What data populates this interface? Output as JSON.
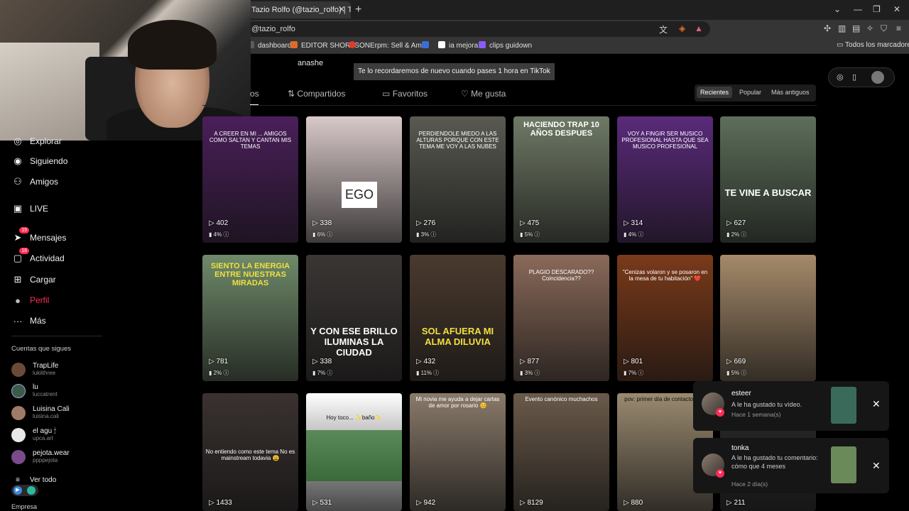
{
  "browser": {
    "tab_title": "Tazio Rolfo (@tazio_rolfo) | TikTok",
    "tab_close": "✕",
    "new_tab": "+",
    "url": "@tazio_rolfo",
    "window_controls": [
      "⌄",
      "—",
      "❐",
      "✕"
    ],
    "bookmarks": [
      {
        "label": "dashboard",
        "color": "#5b5b5b"
      },
      {
        "label": "EDITOR SHORTS",
        "color": "#e06a2c"
      },
      {
        "label": "ONErpm: Sell & Am...",
        "color": "#e03a2c"
      },
      {
        "label": "",
        "color": "#3b6fd8"
      },
      {
        "label": "ia mejora",
        "color": "#ffffff"
      },
      {
        "label": "clips guidown",
        "color": "#8a5cf6"
      }
    ],
    "bookmarks_folder": "Todos los marcadores"
  },
  "sidebar": {
    "items": [
      {
        "label": "Explorar",
        "icon": "compass-icon",
        "glyph": "◎"
      },
      {
        "label": "Siguiendo",
        "icon": "following-avatar-icon",
        "glyph": "◉"
      },
      {
        "label": "Amigos",
        "icon": "friends-icon",
        "glyph": "⚇"
      },
      {
        "label": "LIVE",
        "icon": "live-icon",
        "glyph": "▣"
      },
      {
        "label": "Mensajes",
        "icon": "messages-icon",
        "glyph": "➤",
        "badge": "19"
      },
      {
        "label": "Actividad",
        "icon": "activity-icon",
        "glyph": "▢",
        "badge": "18"
      },
      {
        "label": "Cargar",
        "icon": "upload-icon",
        "glyph": "⊞"
      },
      {
        "label": "Perfil",
        "icon": "profile-avatar-icon",
        "glyph": "●"
      },
      {
        "label": "Más",
        "icon": "more-icon",
        "glyph": "···"
      }
    ],
    "following_title": "Cuentas que sigues",
    "following": [
      {
        "name": "TrapLife",
        "handle": "lukiithree",
        "color": "#6b4a3a"
      },
      {
        "name": "lu",
        "handle": "luccatrent",
        "color": "#3c5a4a"
      },
      {
        "name": "Luisina Cali",
        "handle": "luisina.cali",
        "color": "#a07a6a"
      },
      {
        "name": "el agu 🕯",
        "handle": "upca.art",
        "color": "#e8e8e8"
      },
      {
        "name": "pejota.wear",
        "handle": "ppppejota",
        "color": "#7a4a8a"
      }
    ],
    "see_all": "Ver todo",
    "company": "Empresa"
  },
  "profile": {
    "name": "anashe",
    "tooltip": "Te lo recordaremos de nuevo cuando pases 1 hora en TikTok",
    "tabs": [
      "os",
      "Compartidos",
      "Favoritos",
      "Me gusta"
    ],
    "tab_icons": [
      "",
      "⇅",
      "▭",
      "♡"
    ],
    "sort": [
      "Recientes",
      "Popular",
      "Más antiguos"
    ]
  },
  "videos": [
    {
      "caption": "A CREER EN MI ... AMIGOS COMO SALTAN Y CANTAN MIS TEMAS",
      "views": "402",
      "pct": "4%",
      "bg": "#4a1f5a",
      "cap_color": "#ffffff"
    },
    {
      "caption": "EGO",
      "views": "338",
      "pct": "6%",
      "bg": "#d9c9c9",
      "cap_color": "#222222"
    },
    {
      "caption": "PERDIENDOLE MIEDO A LAS ALTURAS PORQUE CON ESTE TEMA ME VOY A LAS NUBES",
      "views": "276",
      "pct": "3%",
      "bg": "#5a5a52",
      "cap_color": "#ffffff"
    },
    {
      "caption": "HACIENDO TRAP 10 AÑOS DESPUES",
      "views": "475",
      "pct": "5%",
      "bg": "#6f7a66",
      "cap_color": "#ffffff"
    },
    {
      "caption": "VOY A FINGIR SER MUSICO PROFESIONAL HASTA QUE SEA MUSICO PROFESIONAL",
      "views": "314",
      "pct": "4%",
      "bg": "#5a2a7a",
      "cap_color": "#ffffff"
    },
    {
      "caption": "TE VINE A BUSCAR",
      "views": "627",
      "pct": "2%",
      "bg": "#5d6f5a",
      "cap_color": "#ffffff"
    },
    {
      "caption": "SIENTO LA ENERGIA ENTRE NUESTRAS MIRADAS",
      "views": "781",
      "pct": "2%",
      "bg": "#6f8a6a",
      "cap_color": "#f0e040"
    },
    {
      "caption": "Y CON ESE BRILLO ILUMINAS LA CIUDAD",
      "views": "338",
      "pct": "7%",
      "bg": "#3a3634",
      "cap_color": "#ffffff"
    },
    {
      "caption": "SOL AFUERA MI ALMA DILUVIA",
      "views": "432",
      "pct": "11%",
      "bg": "#4a3a2e",
      "cap_color": "#f0e040"
    },
    {
      "caption": "PLAGIO DESCARADO?? Coincidencia??",
      "views": "877",
      "pct": "3%",
      "bg": "#8a6a5a",
      "cap_color": "#ffffff"
    },
    {
      "caption": "\"Cenizas volaron y se posaron en la mesa de tu habitación\" ❤️",
      "views": "801",
      "pct": "7%",
      "bg": "#7a3a1a",
      "cap_color": "#ffffff"
    },
    {
      "caption": "",
      "views": "669",
      "pct": "5%",
      "bg": "#a58a6a",
      "cap_color": "#ffffff"
    },
    {
      "caption": "No entiendo como este tema No es mainstream todavia 😩",
      "views": "1433",
      "pct": "",
      "bg": "#3a3230",
      "cap_color": "#ffffff"
    },
    {
      "caption": "Hoy toco... ✨baño✨",
      "views": "531",
      "pct": "",
      "bg": "#ffffff",
      "cap_color": "#111111"
    },
    {
      "caption": "Mi novia me ayuda a dejar cartas de amor por rosario 😊",
      "views": "942",
      "pct": "",
      "bg": "#8a7a6a",
      "cap_color": "#ffffff"
    },
    {
      "caption": "Evento canónico muchachos",
      "views": "8129",
      "pct": "",
      "bg": "#6a5a4a",
      "cap_color": "#ffffff"
    },
    {
      "caption": "pov: primer día de contacto cero",
      "views": "880",
      "pct": "",
      "bg": "#9a8a70",
      "cap_color": "#111111"
    },
    {
      "caption": "",
      "views": "211",
      "pct": "",
      "bg": "#2a2a2a",
      "cap_color": "#ffffff"
    }
  ],
  "notifications": [
    {
      "user": "esteer",
      "message": "A le ha gustado tu vídeo.",
      "time": "Hace 1 semana(s)",
      "thumb": "#3a6a5a",
      "close": "✕"
    },
    {
      "user": "tonka",
      "message": "A le ha gustado tu comentario: cómo que 4 meses",
      "time": "Hace 2 día(s)",
      "thumb": "#6a8a5a",
      "close": "✕"
    }
  ]
}
